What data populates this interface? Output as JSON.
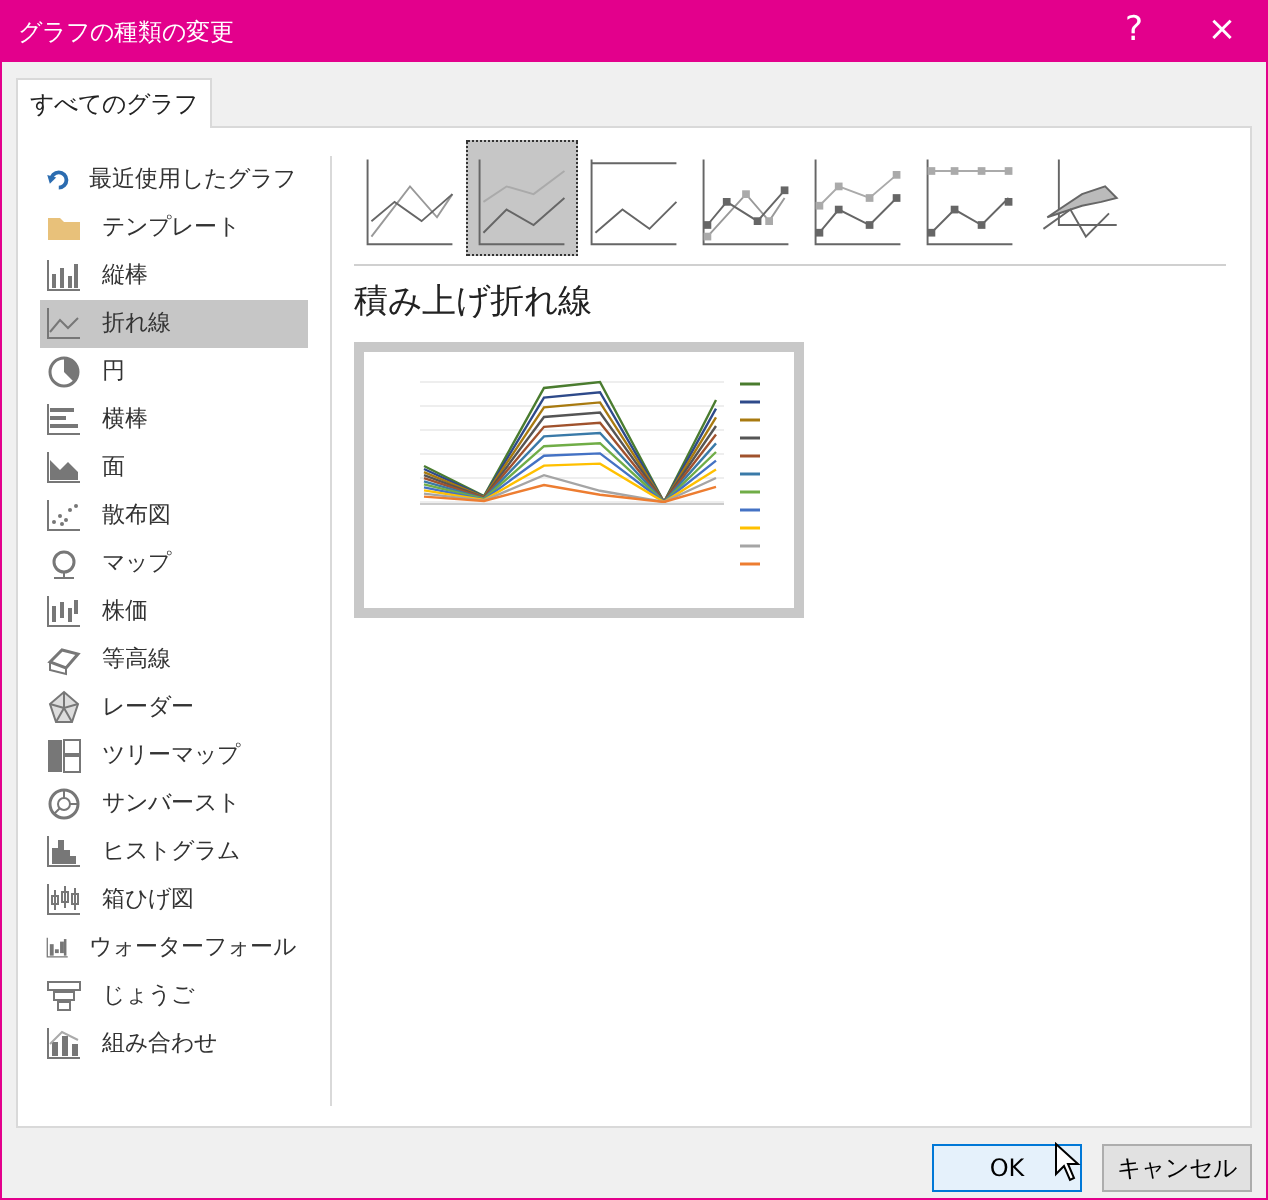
{
  "window": {
    "title": "グラフの種類の変更",
    "help": "?",
    "close": "×"
  },
  "tabs": [
    {
      "label": "すべてのグラフ",
      "selected": true
    }
  ],
  "sidebar": {
    "items": [
      {
        "label": "最近使用したグラフ",
        "selected": false
      },
      {
        "label": "テンプレート",
        "selected": false
      },
      {
        "label": "縦棒",
        "selected": false
      },
      {
        "label": "折れ線",
        "selected": true
      },
      {
        "label": "円",
        "selected": false
      },
      {
        "label": "横棒",
        "selected": false
      },
      {
        "label": "面",
        "selected": false
      },
      {
        "label": "散布図",
        "selected": false
      },
      {
        "label": "マップ",
        "selected": false
      },
      {
        "label": "株価",
        "selected": false
      },
      {
        "label": "等高線",
        "selected": false
      },
      {
        "label": "レーダー",
        "selected": false
      },
      {
        "label": "ツリーマップ",
        "selected": false
      },
      {
        "label": "サンバースト",
        "selected": false
      },
      {
        "label": "ヒストグラム",
        "selected": false
      },
      {
        "label": "箱ひげ図",
        "selected": false
      },
      {
        "label": "ウォーターフォール",
        "selected": false
      },
      {
        "label": "じょうご",
        "selected": false
      },
      {
        "label": "組み合わせ",
        "selected": false
      }
    ]
  },
  "subtypes": [
    {
      "selected": false
    },
    {
      "selected": true
    },
    {
      "selected": false
    },
    {
      "selected": false
    },
    {
      "selected": false
    },
    {
      "selected": false
    },
    {
      "selected": false
    }
  ],
  "subtype_title": "積み上げ折れ線",
  "buttons": [
    {
      "label": "OK",
      "kind": "default"
    },
    {
      "label": "キャンセル",
      "kind": "normal"
    }
  ]
}
